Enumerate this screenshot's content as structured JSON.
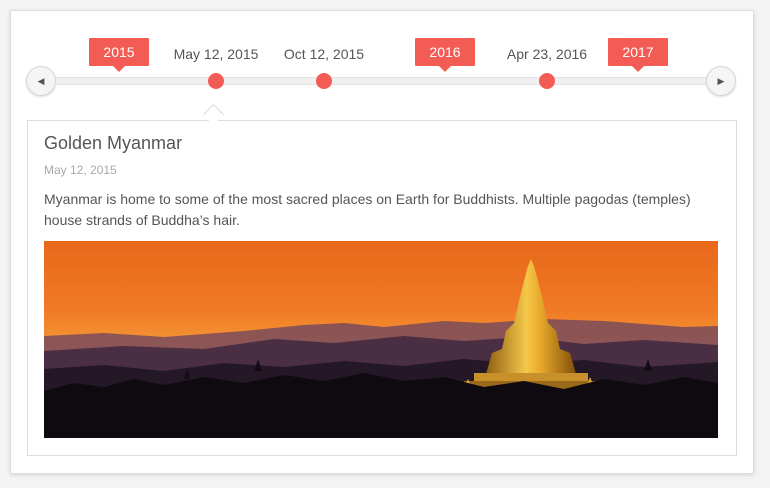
{
  "timeline": {
    "years": [
      "2015",
      "2016",
      "2017"
    ],
    "events": [
      {
        "date": "May 12, 2015"
      },
      {
        "date": "Oct 12, 2015"
      },
      {
        "date": "Apr 23, 2016"
      }
    ],
    "prev_icon": "triangle-left-icon",
    "next_icon": "triangle-right-icon"
  },
  "selected_event": {
    "title": "Golden Myanmar",
    "date": "May 12, 2015",
    "description": "Myanmar is home to some of the most sacred places on Earth for Buddhists. Multiple pagodas (temples) house strands of Buddha’s hair."
  },
  "colors": {
    "accent": "#f25c54",
    "text": "#555555",
    "muted": "#a8a8a8"
  }
}
